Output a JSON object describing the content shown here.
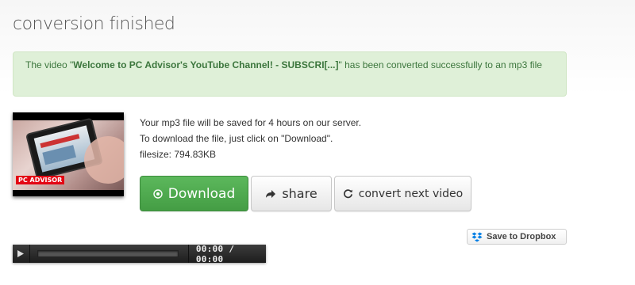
{
  "page": {
    "title": "conversion finished"
  },
  "alert": {
    "prefix": "The video \"",
    "video_title": "Welcome to PC Advisor's YouTube Channel! - SUBSCRI[...]",
    "suffix": "\" has been converted successfully to an mp3 file"
  },
  "thumbnail": {
    "logo_text": "PC ADVISOR"
  },
  "info": {
    "line1": "Your mp3 file will be saved for 4 hours on our server.",
    "line2": "To download the file, just click on \"Download\".",
    "filesize": "filesize: 794.83KB"
  },
  "buttons": {
    "download": {
      "label": "Download",
      "icon": "download-circle-icon"
    },
    "share": {
      "label": "share",
      "icon": "share-arrow-icon"
    },
    "convert_next": {
      "label": "convert next video",
      "icon": "refresh-icon"
    }
  },
  "dropbox": {
    "label": "Save to Dropbox",
    "icon": "dropbox-icon"
  },
  "player": {
    "time": "00:00 / 00:00",
    "play_icon": "play-icon"
  },
  "colors": {
    "success_bg": "#dff0d8",
    "success_text": "#3c763d",
    "download_green": "#5cb85c",
    "dropbox_blue": "#007ee5"
  }
}
